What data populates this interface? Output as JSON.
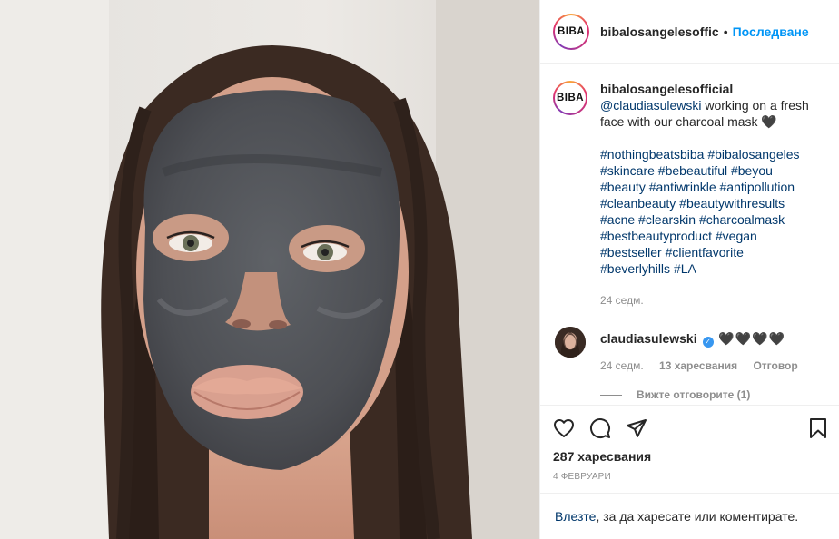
{
  "header": {
    "brand_avatar_text": "BIBA",
    "username": "bibalosangelesoffic",
    "separator": "•",
    "follow_label": "Последване"
  },
  "caption": {
    "avatar_text": "BIBA",
    "username": "bibalosangelesofficial",
    "mention": "@claudiasulewski",
    "text": " working on a fresh face with our charcoal mask 🖤",
    "hashtags": "#nothingbeatsbiba #bibalosangeles #skincare #bebeautiful #beyou #beauty #antiwrinkle #antipollution #cleanbeauty #beautywithresults #acne #clearskin #charcoalmask #bestbeautyproduct #vegan #bestseller #clientfavorite #beverlyhills #LA",
    "time": "24 седм."
  },
  "comment": {
    "username": "claudiasulewski",
    "verified_mark": "✓",
    "text": "🖤🖤🖤🖤",
    "time": "24 седм.",
    "likes": "13 харесвания",
    "reply_label": "Отговор",
    "view_replies": "Вижте отговорите (1)"
  },
  "actions": {
    "icons": [
      "heart-icon",
      "comment-icon",
      "share-icon",
      "bookmark-icon"
    ],
    "likes": "287 харесвания",
    "date": "4 ФЕВРУАРИ"
  },
  "login": {
    "link": "Влезте",
    "rest": ", за да харесате или коментирате."
  },
  "colors": {
    "link_blue": "#0095f6",
    "hashtag": "#00376b",
    "muted": "#8e8e8e",
    "text": "#262626"
  }
}
